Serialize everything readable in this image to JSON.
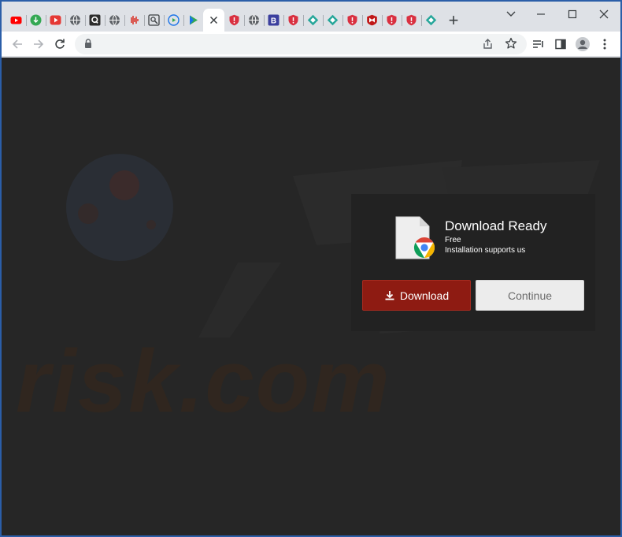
{
  "browser": {
    "tabs": [
      {
        "icon": "youtube-icon",
        "color": "#ff0000"
      },
      {
        "icon": "green-download-icon",
        "color": "#34a853"
      },
      {
        "icon": "red-play-icon",
        "color": "#e53935"
      },
      {
        "icon": "globe-icon",
        "color": "#5f6368"
      },
      {
        "icon": "q-icon",
        "color": "#2d2d2d"
      },
      {
        "icon": "globe-icon",
        "color": "#5f6368"
      },
      {
        "icon": "waveform-icon",
        "color": "#d93025"
      },
      {
        "icon": "image-search-icon",
        "color": "#3c4043"
      },
      {
        "icon": "media-play-icon",
        "color": "#1a73e8"
      },
      {
        "icon": "play-triangle-icon",
        "color": "#34a853"
      },
      {
        "icon": "close-icon",
        "color": "#3c4043",
        "active": true
      },
      {
        "icon": "shield-icon",
        "color": "#d93040"
      },
      {
        "icon": "globe-icon",
        "color": "#5f6368"
      },
      {
        "icon": "b-icon",
        "color": "#3b3f9e"
      },
      {
        "icon": "shield-icon",
        "color": "#d93040"
      },
      {
        "icon": "diamond-icon",
        "color": "#26a69a"
      },
      {
        "icon": "diamond-icon",
        "color": "#26a69a"
      },
      {
        "icon": "shield-icon",
        "color": "#d93040"
      },
      {
        "icon": "mcafee-icon",
        "color": "#c01818"
      },
      {
        "icon": "shield-icon",
        "color": "#d93040"
      },
      {
        "icon": "shield-icon",
        "color": "#d93040"
      },
      {
        "icon": "diamond-icon",
        "color": "#26a69a"
      }
    ],
    "new_tab_label": "+",
    "window_controls": [
      "chevron-down-icon",
      "minimize-icon",
      "maximize-icon",
      "close-icon"
    ]
  },
  "page": {
    "watermark": "risk.com",
    "panel": {
      "title": "Download Ready",
      "line1": "Free",
      "line2": "Installation supports us",
      "download_label": "Download",
      "continue_label": "Continue"
    }
  },
  "colors": {
    "download_button": "#8e1b12",
    "continue_button": "#ececec",
    "page_background": "#262626"
  }
}
